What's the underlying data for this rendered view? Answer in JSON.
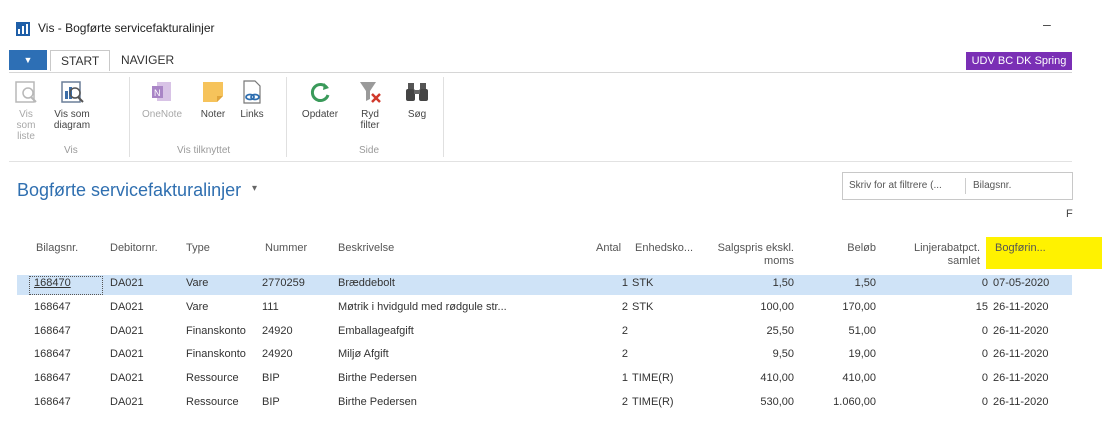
{
  "window": {
    "title": "Vis - Bogførte servicefakturalinjer",
    "minimize": "–"
  },
  "tabs": {
    "start": "START",
    "naviger": "NAVIGER"
  },
  "company": "UDV BC DK Spring",
  "ribbon": {
    "vis_som_liste": "Vis som\nliste",
    "vis_som_diagram": "Vis som\ndiagram",
    "onenote": "OneNote",
    "noter": "Noter",
    "links": "Links",
    "opdater": "Opdater",
    "ryd_filter": "Ryd\nfilter",
    "soeg": "Søg",
    "group_vis": "Vis",
    "group_vis_tilknyttet": "Vis tilknyttet",
    "group_side": "Side"
  },
  "page": {
    "title": "Bogførte servicefakturalinjer",
    "caret": "▾"
  },
  "filter": {
    "placeholder": "Skriv for at filtrere (...",
    "field": "Bilagsnr.",
    "extra": "F"
  },
  "columns": {
    "bilagsnr": "Bilagsnr.",
    "debitornr": "Debitornr.",
    "type": "Type",
    "nummer": "Nummer",
    "beskrivelse": "Beskrivelse",
    "antal": "Antal",
    "enhedskode": "Enhedsko...",
    "salgspris": "Salgspris ekskl.\nmoms",
    "beloeb": "Beløb",
    "linjerabat": "Linjerabatpct.\nsamlet",
    "bogfoering": "Bogførin..."
  },
  "rows": [
    {
      "bilagsnr": "168470",
      "debitornr": "DA021",
      "type": "Vare",
      "nummer": "2770259",
      "beskrivelse": "Bræddebolt",
      "antal": "1",
      "enhed": "STK",
      "salgspris": "1,50",
      "beloeb": "1,50",
      "rabat": "0",
      "dato": "07-05-2020"
    },
    {
      "bilagsnr": "168647",
      "debitornr": "DA021",
      "type": "Vare",
      "nummer": "111",
      "beskrivelse": "Møtrik i hvidguld med rødgule str...",
      "antal": "2",
      "enhed": "STK",
      "salgspris": "100,00",
      "beloeb": "170,00",
      "rabat": "15",
      "dato": "26-11-2020"
    },
    {
      "bilagsnr": "168647",
      "debitornr": "DA021",
      "type": "Finanskonto",
      "nummer": "24920",
      "beskrivelse": "Emballageafgift",
      "antal": "2",
      "enhed": "",
      "salgspris": "25,50",
      "beloeb": "51,00",
      "rabat": "0",
      "dato": "26-11-2020"
    },
    {
      "bilagsnr": "168647",
      "debitornr": "DA021",
      "type": "Finanskonto",
      "nummer": "24920",
      "beskrivelse": "Miljø Afgift",
      "antal": "2",
      "enhed": "",
      "salgspris": "9,50",
      "beloeb": "19,00",
      "rabat": "0",
      "dato": "26-11-2020"
    },
    {
      "bilagsnr": "168647",
      "debitornr": "DA021",
      "type": "Ressource",
      "nummer": "BIP",
      "beskrivelse": "Birthe Pedersen",
      "antal": "1",
      "enhed": "TIME(R)",
      "salgspris": "410,00",
      "beloeb": "410,00",
      "rabat": "0",
      "dato": "26-11-2020"
    },
    {
      "bilagsnr": "168647",
      "debitornr": "DA021",
      "type": "Ressource",
      "nummer": "BIP",
      "beskrivelse": "Birthe Pedersen",
      "antal": "2",
      "enhed": "TIME(R)",
      "salgspris": "530,00",
      "beloeb": "1.060,00",
      "rabat": "0",
      "dato": "26-11-2020"
    }
  ],
  "colors": {
    "accent": "#2f6fb0",
    "selected_row": "#cfe3f7",
    "highlight": "#fff200",
    "company_badge": "#7a2fb5"
  }
}
